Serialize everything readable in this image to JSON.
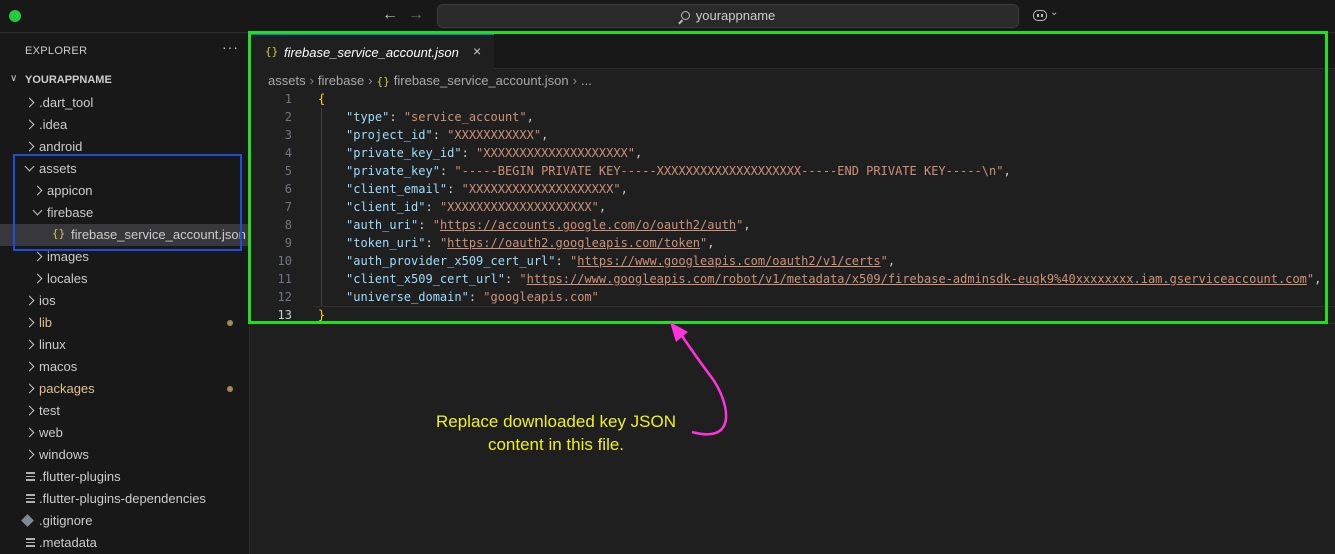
{
  "titlebar": {
    "search_text": "yourappname"
  },
  "sidebar": {
    "title": "EXPLORER",
    "more": "···",
    "root": "YOURAPPNAME",
    "items": [
      {
        "label": ".dart_tool",
        "kind": "folder",
        "state": "closed",
        "depth": 0,
        "modified": false
      },
      {
        "label": ".idea",
        "kind": "folder",
        "state": "closed",
        "depth": 0,
        "modified": false
      },
      {
        "label": "android",
        "kind": "folder",
        "state": "closed",
        "depth": 0,
        "modified": false
      },
      {
        "label": "assets",
        "kind": "folder",
        "state": "open",
        "depth": 0,
        "modified": false
      },
      {
        "label": "appicon",
        "kind": "folder",
        "state": "closed",
        "depth": 1,
        "modified": false
      },
      {
        "label": "firebase",
        "kind": "folder",
        "state": "open",
        "depth": 1,
        "modified": false
      },
      {
        "label": "firebase_service_account.json",
        "kind": "json",
        "state": "",
        "depth": 2,
        "modified": false,
        "selected": true
      },
      {
        "label": "images",
        "kind": "folder",
        "state": "closed",
        "depth": 1,
        "modified": false
      },
      {
        "label": "locales",
        "kind": "folder",
        "state": "closed",
        "depth": 1,
        "modified": false
      },
      {
        "label": "ios",
        "kind": "folder",
        "state": "closed",
        "depth": 0,
        "modified": false
      },
      {
        "label": "lib",
        "kind": "folder",
        "state": "closed",
        "depth": 0,
        "modified": true
      },
      {
        "label": "linux",
        "kind": "folder",
        "state": "closed",
        "depth": 0,
        "modified": false
      },
      {
        "label": "macos",
        "kind": "folder",
        "state": "closed",
        "depth": 0,
        "modified": false
      },
      {
        "label": "packages",
        "kind": "folder",
        "state": "closed",
        "depth": 0,
        "modified": true
      },
      {
        "label": "test",
        "kind": "folder",
        "state": "closed",
        "depth": 0,
        "modified": false
      },
      {
        "label": "web",
        "kind": "folder",
        "state": "closed",
        "depth": 0,
        "modified": false
      },
      {
        "label": "windows",
        "kind": "folder",
        "state": "closed",
        "depth": 0,
        "modified": false
      },
      {
        "label": ".flutter-plugins",
        "kind": "lines",
        "state": "",
        "depth": 0,
        "modified": false
      },
      {
        "label": ".flutter-plugins-dependencies",
        "kind": "lines",
        "state": "",
        "depth": 0,
        "modified": false
      },
      {
        "label": ".gitignore",
        "kind": "git",
        "state": "",
        "depth": 0,
        "modified": false
      },
      {
        "label": ".metadata",
        "kind": "lines",
        "state": "",
        "depth": 0,
        "modified": false
      }
    ]
  },
  "editor": {
    "tab_label": "firebase_service_account.json",
    "tab_icon": "{}",
    "tab_close": "×",
    "breadcrumb": [
      "assets",
      "firebase",
      "firebase_service_account.json",
      "..."
    ],
    "lines": [
      {
        "n": "1",
        "key": "",
        "value": "",
        "raw": "{"
      },
      {
        "n": "2",
        "key": "\"type\"",
        "value": "\"service_account\"",
        "comma": ","
      },
      {
        "n": "3",
        "key": "\"project_id\"",
        "value": "\"XXXXXXXXXXX\"",
        "comma": ","
      },
      {
        "n": "4",
        "key": "\"private_key_id\"",
        "value": "\"XXXXXXXXXXXXXXXXXXXX\"",
        "comma": ","
      },
      {
        "n": "5",
        "key": "\"private_key\"",
        "value": "\"-----BEGIN PRIVATE KEY-----XXXXXXXXXXXXXXXXXXXX-----END PRIVATE KEY-----\\n\"",
        "comma": ","
      },
      {
        "n": "6",
        "key": "\"client_email\"",
        "value": "\"XXXXXXXXXXXXXXXXXXXX\"",
        "comma": ","
      },
      {
        "n": "7",
        "key": "\"client_id\"",
        "value": "\"XXXXXXXXXXXXXXXXXXXX\"",
        "comma": ","
      },
      {
        "n": "8",
        "key": "\"auth_uri\"",
        "value": "https://accounts.google.com/o/oauth2/auth",
        "url": true,
        "comma": ","
      },
      {
        "n": "9",
        "key": "\"token_uri\"",
        "value": "https://oauth2.googleapis.com/token",
        "url": true,
        "comma": ","
      },
      {
        "n": "10",
        "key": "\"auth_provider_x509_cert_url\"",
        "value": "https://www.googleapis.com/oauth2/v1/certs",
        "url": true,
        "comma": ","
      },
      {
        "n": "11",
        "key": "\"client_x509_cert_url\"",
        "value": "https://www.googleapis.com/robot/v1/metadata/x509/firebase-adminsdk-euqk9%40xxxxxxxx.iam.gserviceaccount.com",
        "url": true,
        "comma": ","
      },
      {
        "n": "12",
        "key": "\"universe_domain\"",
        "value": "\"googleapis.com\"",
        "comma": ""
      },
      {
        "n": "13",
        "key": "",
        "value": "",
        "raw": "}"
      }
    ]
  },
  "annotation": {
    "note": "Replace downloaded key JSON content in this file.",
    "box_colors": {
      "editor": "#22dd22",
      "sidebar": "#1c4fd6",
      "arrow": "#ff33dd",
      "note": "#f0f020"
    }
  }
}
